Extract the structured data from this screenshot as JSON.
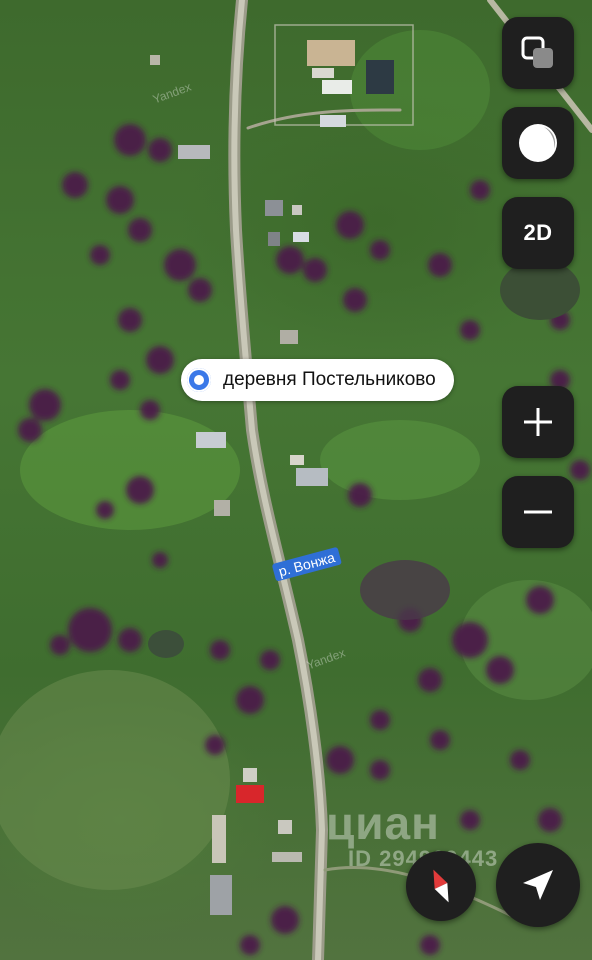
{
  "map": {
    "type": "satellite",
    "place_label": "деревня Постельниково",
    "river_label": "р. Вонжа",
    "watermarks": {
      "yandex_1": "Yandex",
      "yandex_2": "Yandex",
      "cian": "циан",
      "cian_id": "ID 294969443"
    }
  },
  "controls": {
    "layers_icon": "layers-icon",
    "theme_icon": "night-mode-icon",
    "view_mode_label": "2D",
    "zoom_in_icon": "plus-icon",
    "zoom_out_icon": "minus-icon",
    "compass_icon": "compass-needle-icon",
    "locate_icon": "location-arrow-icon"
  },
  "colors": {
    "control_bg": "#1f1f1f",
    "pin_blue": "#3a78e8",
    "river_label_bg": "#2f6fd6",
    "compass_red": "#e23b3b"
  }
}
